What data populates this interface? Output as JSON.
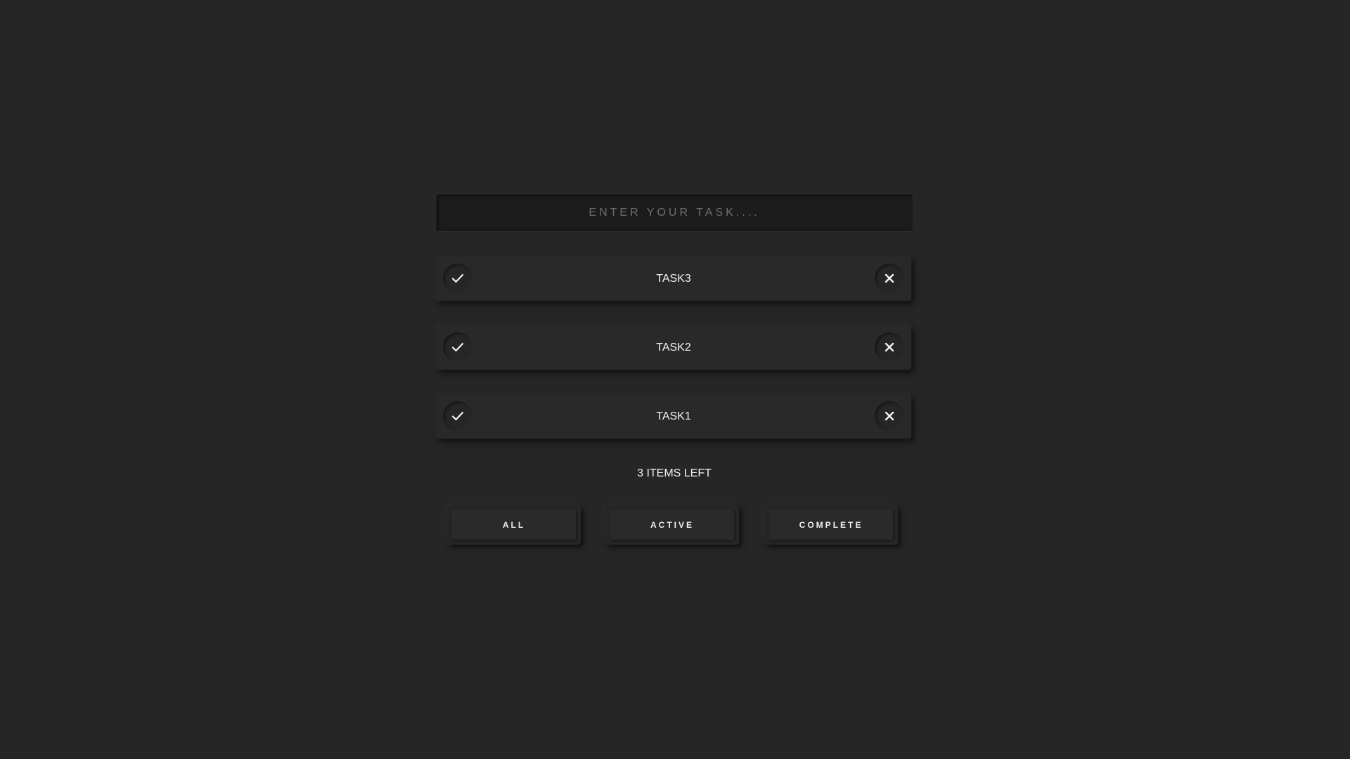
{
  "input": {
    "placeholder": "ENTER YOUR TASK....",
    "value": ""
  },
  "tasks": [
    {
      "label": "TASK3",
      "check_icon": "check-icon",
      "delete_icon": "close-icon"
    },
    {
      "label": "TASK2",
      "check_icon": "check-icon",
      "delete_icon": "close-icon"
    },
    {
      "label": "TASK1",
      "check_icon": "check-icon",
      "delete_icon": "close-icon"
    }
  ],
  "footer": {
    "items_left": "3 ITEMS LEFT"
  },
  "filters": {
    "all": "ALL",
    "active": "ACTIVE",
    "complete": "COMPLETE"
  },
  "colors": {
    "background": "#262626",
    "text": "#f2f2f2",
    "placeholder": "#6e6e6e"
  }
}
